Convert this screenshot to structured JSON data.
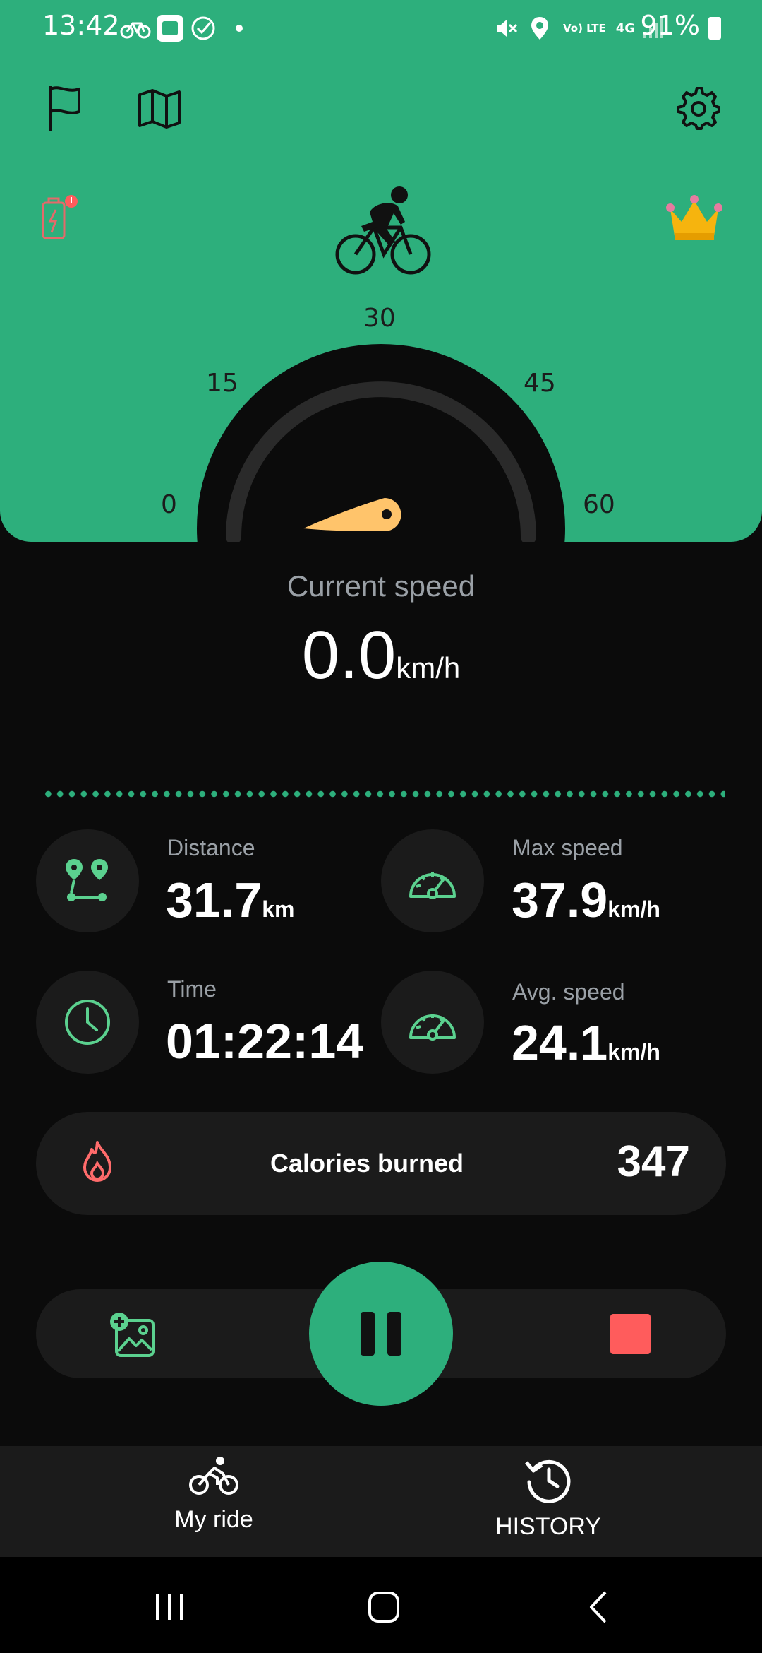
{
  "status_bar": {
    "time": "13:42",
    "battery": "91%",
    "network": "4G",
    "network_sub": "Vo) LTE"
  },
  "header": {
    "flag_icon": "flag-icon",
    "map_icon": "map-icon",
    "settings_icon": "gear-icon",
    "battery_alert_icon": "battery-warning-icon",
    "premium_icon": "crown-icon",
    "rider_icon": "cyclist-icon"
  },
  "gauge": {
    "ticks": [
      "0",
      "15",
      "30",
      "45",
      "60"
    ],
    "value": 0,
    "max": 60
  },
  "current_speed": {
    "label": "Current speed",
    "value": "0.0",
    "unit": "km/h"
  },
  "stats": {
    "distance": {
      "label": "Distance",
      "value": "31.7",
      "unit": "km"
    },
    "max_speed": {
      "label": "Max speed",
      "value": "37.9",
      "unit": "km/h"
    },
    "time": {
      "label": "Time",
      "value": "01:22:14"
    },
    "avg_speed": {
      "label": "Avg. speed",
      "value": "24.1",
      "unit": "km/h"
    }
  },
  "calories": {
    "label": "Calories burned",
    "value": "347"
  },
  "controls": {
    "add_photo_icon": "add-photo-icon",
    "pause_icon": "pause-icon",
    "stop_icon": "stop-icon"
  },
  "bottom_nav": {
    "items": [
      {
        "label": "My ride",
        "icon": "bicycle-icon"
      },
      {
        "label": "HISTORY",
        "icon": "history-icon"
      }
    ]
  },
  "colors": {
    "accent": "#2daf7c",
    "background": "#0b0b0b",
    "card": "#1b1b1b",
    "stop": "#ff5c5c",
    "needle": "#ffc46b"
  }
}
